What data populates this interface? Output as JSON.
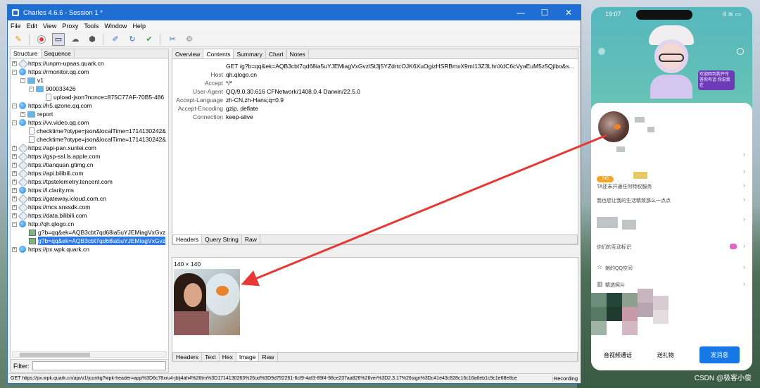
{
  "window": {
    "title": "Charles 4.6.6 - Session 1 *",
    "minimize": "—",
    "maximize": "☐",
    "close": "✕"
  },
  "menu": [
    "File",
    "Edit",
    "View",
    "Proxy",
    "Tools",
    "Window",
    "Help"
  ],
  "left": {
    "tabs": [
      "Structure",
      "Sequence"
    ],
    "filter_label": "Filter:",
    "rows": [
      "https://unpm-upaas.quark.cn",
      "https://rmonitor.qq.com",
      "v1",
      "900033426",
      "upload-json?nonce=875C77AF-70B5-486",
      "https://h5.qzone.qq.com",
      "report",
      "https://vv.video.qq.com",
      "checktime?otype=json&localTime=1714130242&",
      "checktime?otype=json&localTime=1714130242&",
      "https://api-pan.xunlei.com",
      "https://gsp-ssl.ls.apple.com",
      "https://tianquan.gtimg.cn",
      "https://api.bilibili.com",
      "https://tpstelemetry.tencent.com",
      "https://l.clarity.ms",
      "https://gateway.icloud.com.cn",
      "https://mcs.snssdk.com",
      "https://data.bilibili.com",
      "http://qh.qlogo.cn",
      "g?b=qq&ek=AQB3cbt7qd68ia5uYJEMiagVxGvz",
      "g?b=qq&ek=AQB3cbt7qd68ia5uYJEMiagVxGvz",
      "https://px.wpk.quark.cn"
    ]
  },
  "right": {
    "tabs": [
      "Overview",
      "Contents",
      "Summary",
      "Chart",
      "Notes"
    ],
    "request": [
      {
        "k": "",
        "v": "GET /g?b=qq&ek=AQB3cbt7qd68ia5uYJEMiagVxGvzlSt3j5YZdrtcOJK6XuOgizHSRBmxX9mI13Z3LhnXdC6cVyaEuM5z5Qjibo&s..."
      },
      {
        "k": "Host",
        "v": "qh.qlogo.cn"
      },
      {
        "k": "Accept",
        "v": "*/*"
      },
      {
        "k": "User-Agent",
        "v": "QQ/9.0.30.616 CFNetwork/1408.0.4 Darwin/22.5.0"
      },
      {
        "k": "Accept-Language",
        "v": "zh-CN,zh-Hans;q=0.9"
      },
      {
        "k": "Accept-Encoding",
        "v": "gzip, deflate"
      },
      {
        "k": "Connection",
        "v": "keep-alive"
      }
    ],
    "req_subtabs": [
      "Headers",
      "Query String",
      "Raw"
    ],
    "image_size": "140 × 140",
    "resp_subtabs": [
      "Headers",
      "Text",
      "Hex",
      "Image",
      "Raw"
    ]
  },
  "status": {
    "url": "GET https://px.wpk.quark.cn/api/v1/jconfig?wpk-header=app%3D6c78xru4-jblj4ah4%26tm%3D1714130263%26ud%3D9d792261-6cf9-4af3-89f4-98ce237aa826%26ver%3D2.3.17%26sign%3Dc41e43c828c16c16a6eb1c9c1e68e8ce",
    "recording": "Recording"
  },
  "phone": {
    "time": "19:07",
    "signal": "⋅ll ≋ ▭",
    "sign_text": "欢迎回到我开车 答你有话 你说我在",
    "items": [
      "TA还未开通任何特权服务",
      "我也想让我的生活精致那么一点点",
      "你们的互动标识",
      "她的QQ空间",
      "精选照片"
    ],
    "badge": "745",
    "buttons": [
      "音视频通话",
      "送礼物",
      "发消息"
    ]
  },
  "watermark": "CSDN @极客小俊"
}
